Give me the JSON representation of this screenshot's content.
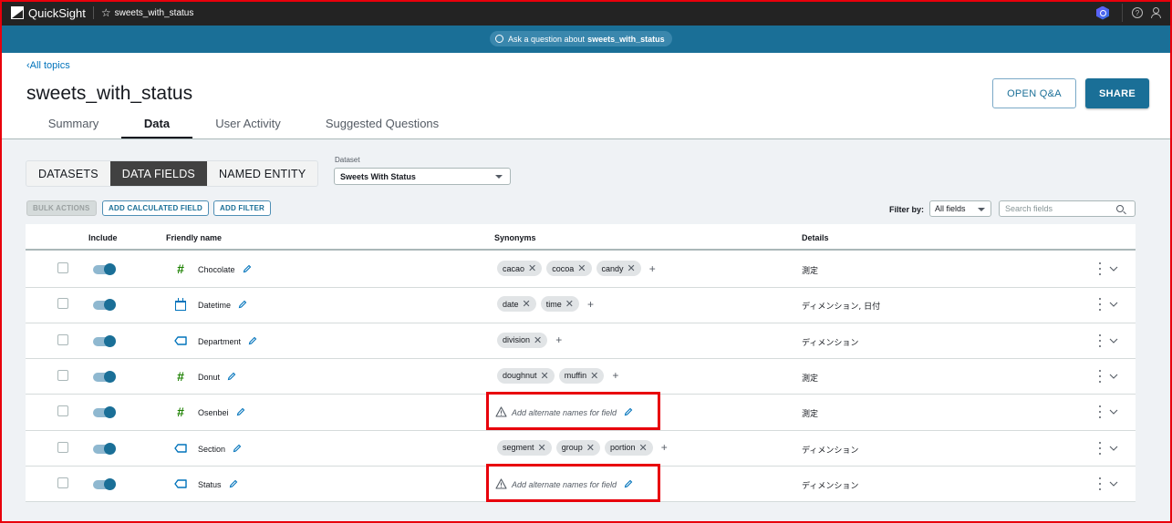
{
  "topbar": {
    "app_name": "QuickSight",
    "topic_title": "sweets_with_status"
  },
  "ask_bar": {
    "prefix": "Ask a question about",
    "topic": "sweets_with_status"
  },
  "header": {
    "back_link": "All topics",
    "title": "sweets_with_status",
    "tabs": [
      {
        "label": "Summary",
        "active": false
      },
      {
        "label": "Data",
        "active": true
      },
      {
        "label": "User Activity",
        "active": false
      },
      {
        "label": "Suggested Questions",
        "active": false
      }
    ],
    "open_qa_label": "OPEN Q&A",
    "share_label": "SHARE"
  },
  "segmented": {
    "items": [
      "DATASETS",
      "DATA FIELDS",
      "NAMED ENTITY"
    ],
    "selected": "DATA FIELDS"
  },
  "dataset": {
    "label": "Dataset",
    "value": "Sweets With Status"
  },
  "actions": {
    "bulk": "BULK ACTIONS",
    "add_calculated": "ADD CALCULATED FIELD",
    "add_filter": "ADD FILTER"
  },
  "filter": {
    "label": "Filter by:",
    "value": "All fields",
    "search_placeholder": "Search fields"
  },
  "table": {
    "columns": {
      "include": "Include",
      "friendly_name": "Friendly name",
      "synonyms": "Synonyms",
      "details": "Details"
    },
    "alt_placeholder": "Add alternate names for field",
    "rows": [
      {
        "name": "Chocolate",
        "type": "measure",
        "included": true,
        "synonyms": [
          "cacao",
          "cocoa",
          "candy"
        ],
        "details": "測定"
      },
      {
        "name": "Datetime",
        "type": "date",
        "included": true,
        "synonyms": [
          "date",
          "time"
        ],
        "details": "ディメンション, 日付"
      },
      {
        "name": "Department",
        "type": "dimension",
        "included": true,
        "synonyms": [
          "division"
        ],
        "details": "ディメンション"
      },
      {
        "name": "Donut",
        "type": "measure",
        "included": true,
        "synonyms": [
          "doughnut",
          "muffin"
        ],
        "details": "測定"
      },
      {
        "name": "Osenbei",
        "type": "measure",
        "included": true,
        "synonyms": [],
        "details": "測定"
      },
      {
        "name": "Section",
        "type": "dimension",
        "included": true,
        "synonyms": [
          "segment",
          "group",
          "portion"
        ],
        "details": "ディメンション"
      },
      {
        "name": "Status",
        "type": "dimension",
        "included": true,
        "synonyms": [],
        "details": "ディメンション"
      }
    ]
  },
  "colors": {
    "accent": "#1a6f97",
    "measure_icon": "#1d8102",
    "dimension_icon": "#0073bb",
    "highlight_box": "#e8000b"
  }
}
